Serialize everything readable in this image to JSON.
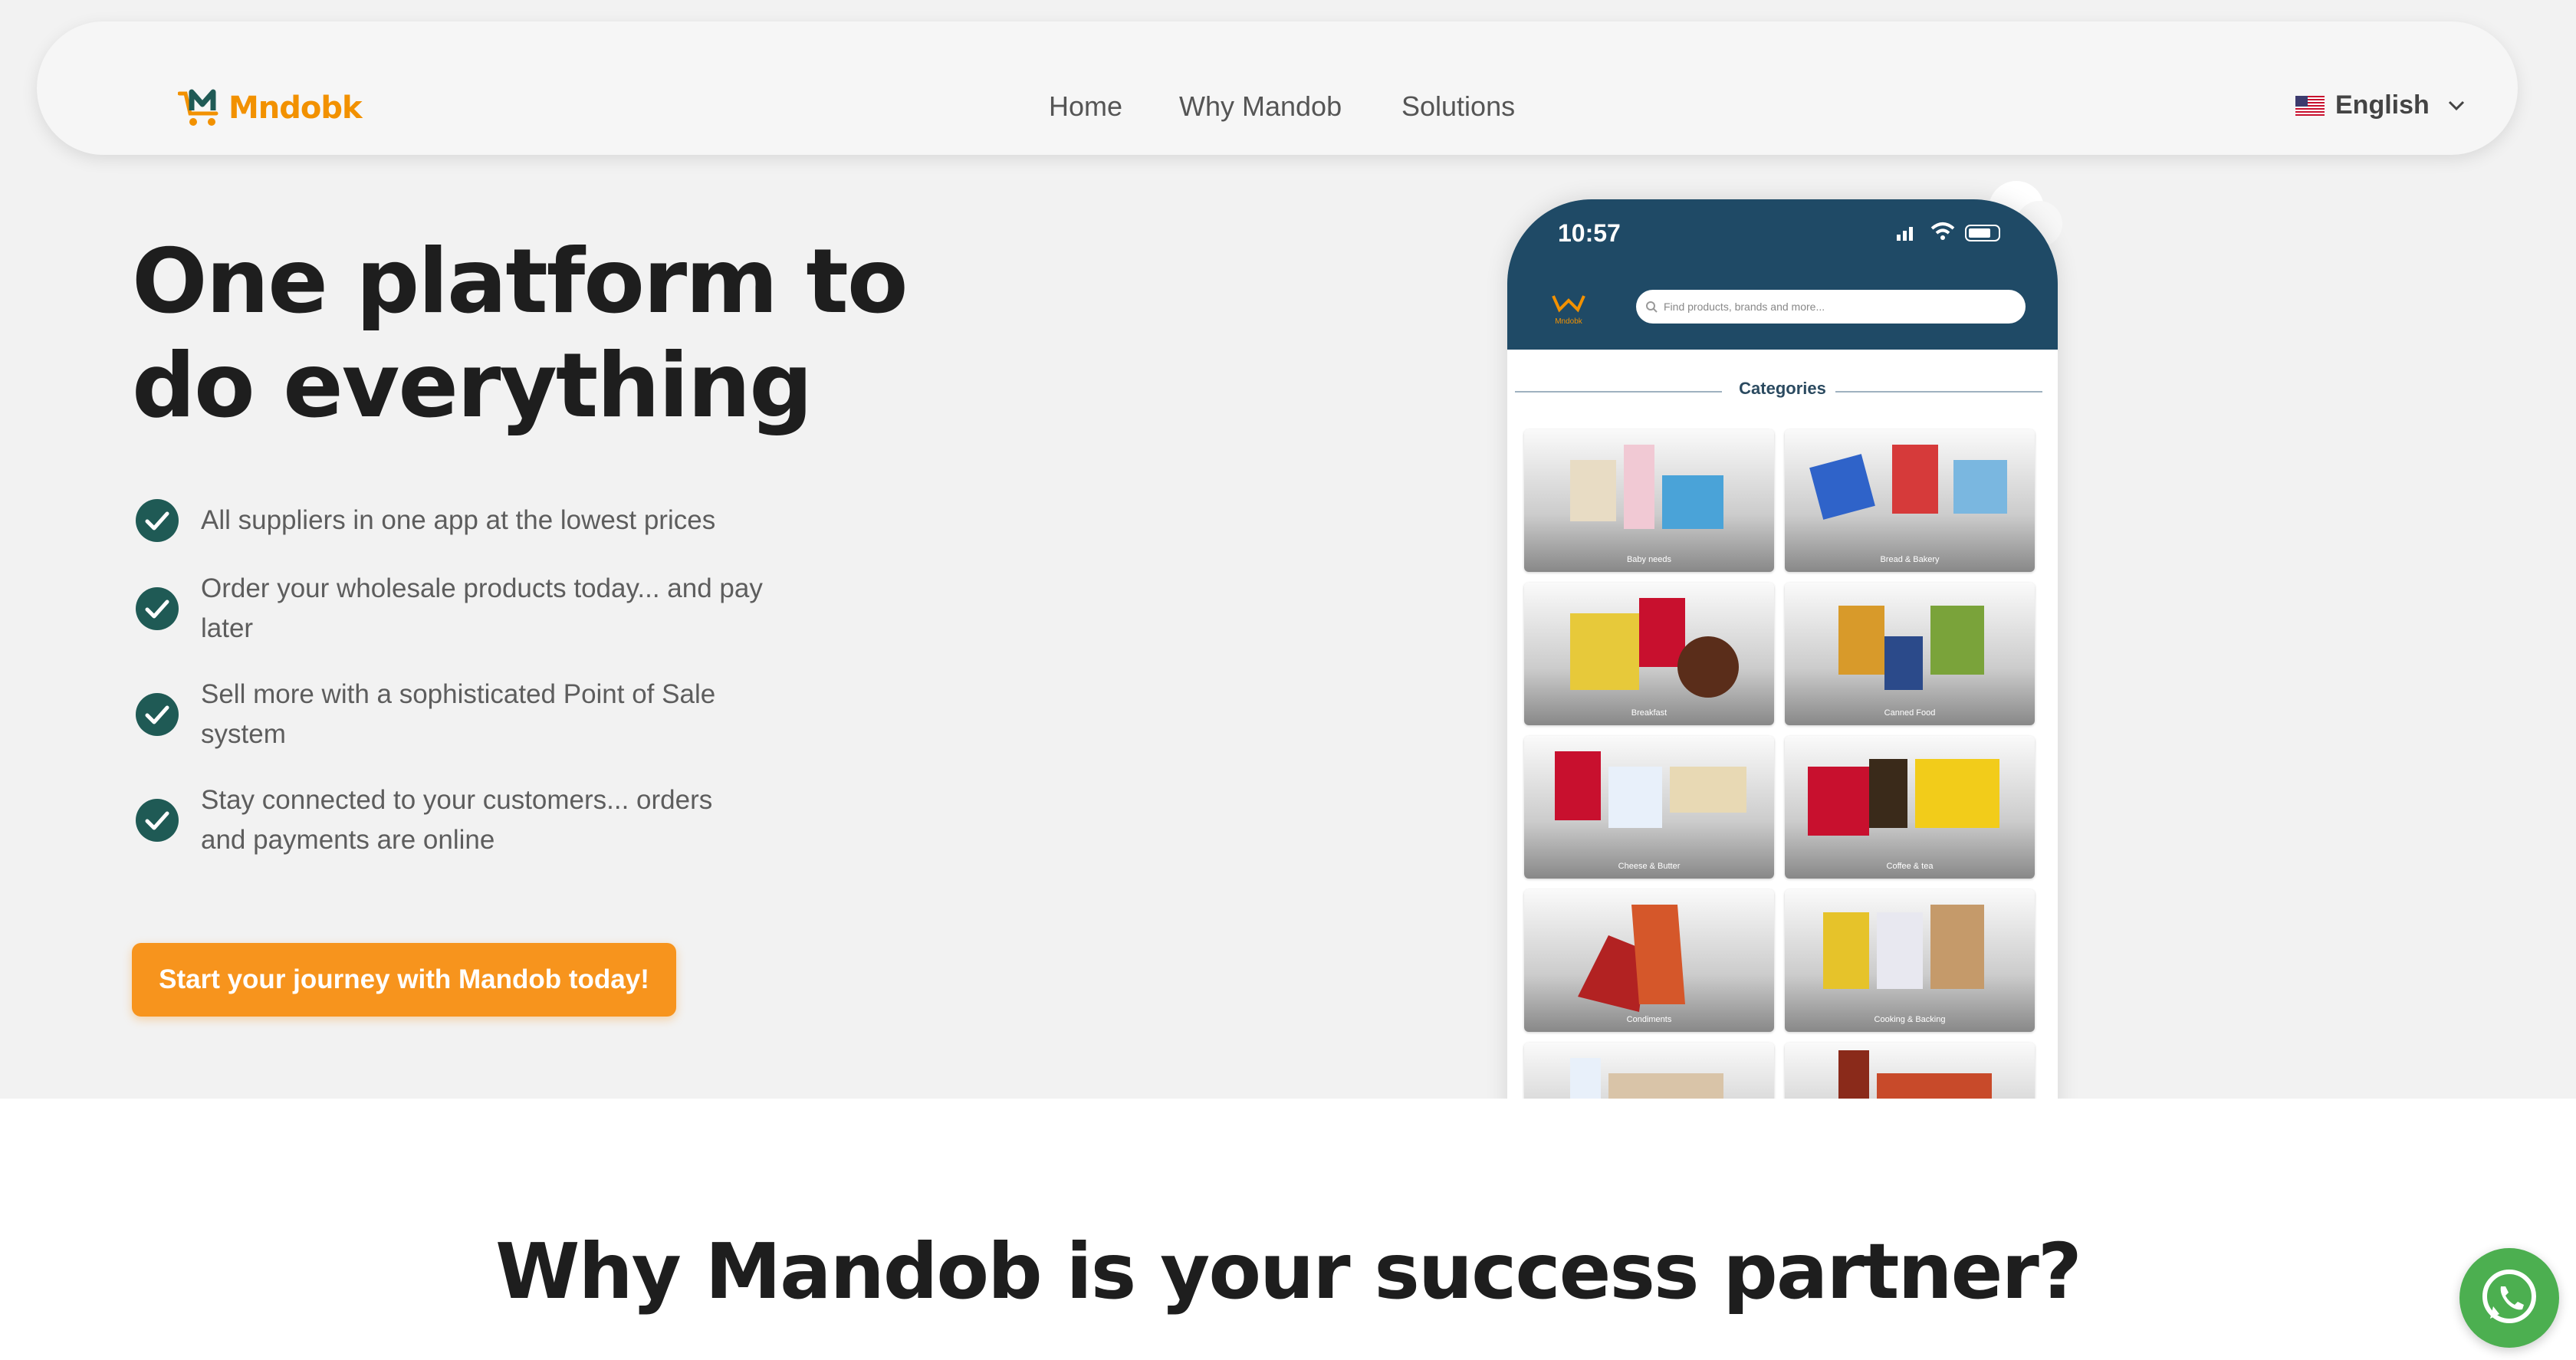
{
  "brand": {
    "logo_text": "Mndobk",
    "logo_color": "#f29100"
  },
  "nav": {
    "links": [
      {
        "label": "Home"
      },
      {
        "label": "Why Mandob"
      },
      {
        "label": "Solutions"
      }
    ],
    "language": {
      "label": "English",
      "flag_icon": "us-flag-icon"
    }
  },
  "hero": {
    "headline": "One platform to do everything",
    "features": [
      {
        "text": "All suppliers in one app at the lowest prices"
      },
      {
        "text": "Order your wholesale products today... and pay later"
      },
      {
        "text": "Sell more with a sophisticated Point of Sale system"
      },
      {
        "text": "Stay connected to your customers... orders and payments are online"
      }
    ],
    "cta_label": "Start your journey with Mandob today!",
    "cta_color": "#f7941d",
    "check_color": "#1f5a55"
  },
  "phone": {
    "status_time": "10:57",
    "app_logo_text": "Mndobk",
    "search_placeholder": "Find products, brands and more...",
    "categories_title": "Categories",
    "categories": [
      {
        "label": "Baby needs"
      },
      {
        "label": "Bread & Bakery"
      },
      {
        "label": "Breakfast"
      },
      {
        "label": "Canned Food"
      },
      {
        "label": "Cheese & Butter"
      },
      {
        "label": "Coffee & tea"
      },
      {
        "label": "Condiments"
      },
      {
        "label": "Cooking & Backing"
      },
      {
        "label": ""
      },
      {
        "label": ""
      }
    ],
    "header_color": "#1f4a66"
  },
  "section": {
    "title": "Why Mandob is your success partner?"
  },
  "whatsapp": {
    "icon": "whatsapp-icon",
    "color": "#4caf50"
  }
}
